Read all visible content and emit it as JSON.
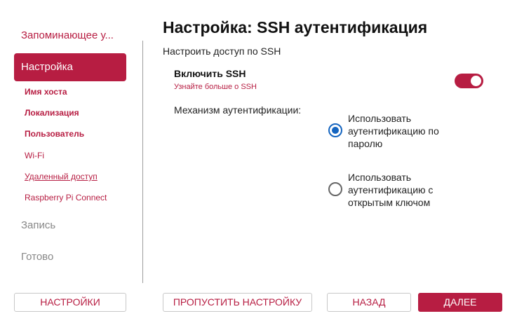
{
  "sidebar": {
    "steps": {
      "storage": "Запоминающее у...",
      "customization": "Настройка",
      "write": "Запись",
      "done": "Готово"
    },
    "sub_items": [
      "Имя хоста",
      "Локализация",
      "Пользователь",
      "Wi-Fi",
      "Удаленный доступ",
      "Raspberry Pi Connect"
    ]
  },
  "main": {
    "title": "Настройка: SSH аутентификация",
    "subtitle": "Настроить доступ по SSH",
    "ssh": {
      "label": "Включить SSH",
      "link": "Узнайте больше о SSH",
      "enabled": true
    },
    "auth": {
      "label": "Механизм аутентификации:",
      "options": [
        {
          "label": "Использовать аутентификацию по паролю",
          "selected": true
        },
        {
          "label": "Использовать аутентификацию с открытым ключом",
          "selected": false
        }
      ]
    }
  },
  "footer": {
    "settings": "НАСТРОЙКИ",
    "skip": "ПРОПУСТИТЬ НАСТРОЙКУ",
    "back": "НАЗАД",
    "next": "ДАЛЕЕ"
  },
  "colors": {
    "accent": "#b71d42",
    "radio": "#1565c0",
    "inactive_step": "#888888"
  }
}
